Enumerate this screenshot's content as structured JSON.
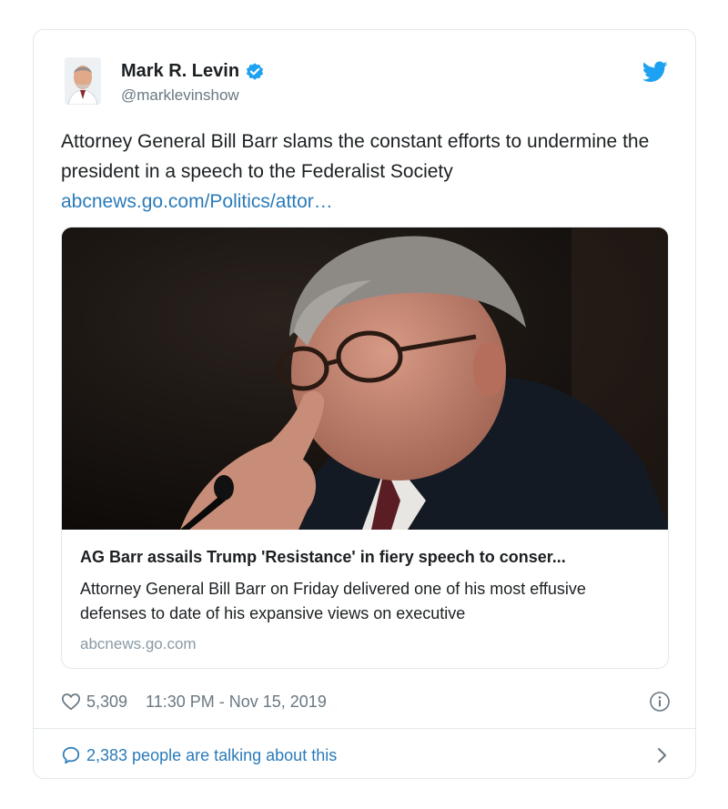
{
  "author": {
    "name": "Mark R. Levin",
    "handle": "@marklevinshow"
  },
  "tweet": {
    "text": "Attorney General Bill Barr slams the constant efforts to undermine the president in a speech to the Federalist Society",
    "link_text": "abcnews.go.com/Politics/attor…"
  },
  "card": {
    "title": "AG Barr assails Trump 'Resistance' in fiery speech to conser...",
    "description": "Attorney General Bill Barr on Friday delivered one of his most effusive defenses to date of his expansive views on executive",
    "domain": "abcnews.go.com"
  },
  "meta": {
    "likes": "5,309",
    "timestamp": "11:30 PM - Nov 15, 2019"
  },
  "footer": {
    "talking": "2,383 people are talking about this"
  },
  "icons": {
    "verified": "verified-badge-icon",
    "bird": "twitter-bird-icon",
    "heart": "heart-icon",
    "info": "info-icon",
    "bubble": "speech-bubble-icon",
    "chevron": "chevron-right-icon"
  },
  "colors": {
    "link": "#2b7bb9",
    "verified": "#1da1f2",
    "muted": "#697882",
    "border": "#e1e8ed"
  }
}
